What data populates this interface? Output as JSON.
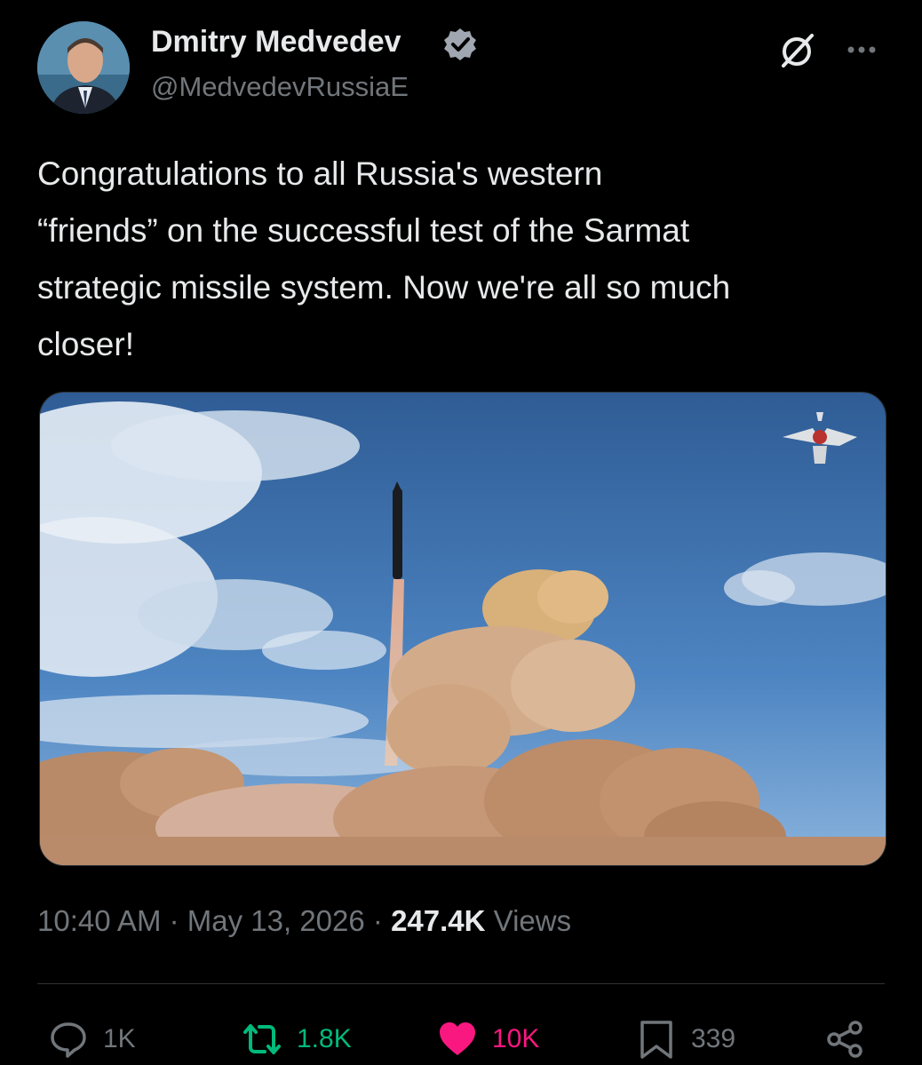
{
  "author": {
    "display_name": "Dmitry Medvedev",
    "handle": "@MedvedevRussiaE",
    "verified_icon": "verified-badge-icon",
    "verified_color": "#a0a7b1"
  },
  "header_actions": {
    "grok_icon": "grok-icon",
    "more_icon": "more-dots-icon"
  },
  "tweet": {
    "text": "Congratulations to all Russia's western\n“friends” on the successful test of the Sarmat\nstrategic missile system. Now we're all so much\ncloser!"
  },
  "meta": {
    "time": "10:40 AM",
    "separator": " · ",
    "date": "May 13, 2026",
    "views_count": "247.4K",
    "views_label": " Views"
  },
  "actions": {
    "reply": {
      "icon": "reply-icon",
      "count": "1K"
    },
    "repost": {
      "icon": "repost-icon",
      "count": "1.8K",
      "color": "#00ba7c"
    },
    "like": {
      "icon": "heart-icon",
      "count": "10K",
      "color": "#f91880"
    },
    "bookmark": {
      "icon": "bookmark-icon",
      "count": "339"
    },
    "share": {
      "icon": "share-icon"
    }
  },
  "colors": {
    "background": "#000000",
    "text_primary": "#e7e9ea",
    "text_secondary": "#71767b",
    "divider": "#2f3336"
  }
}
